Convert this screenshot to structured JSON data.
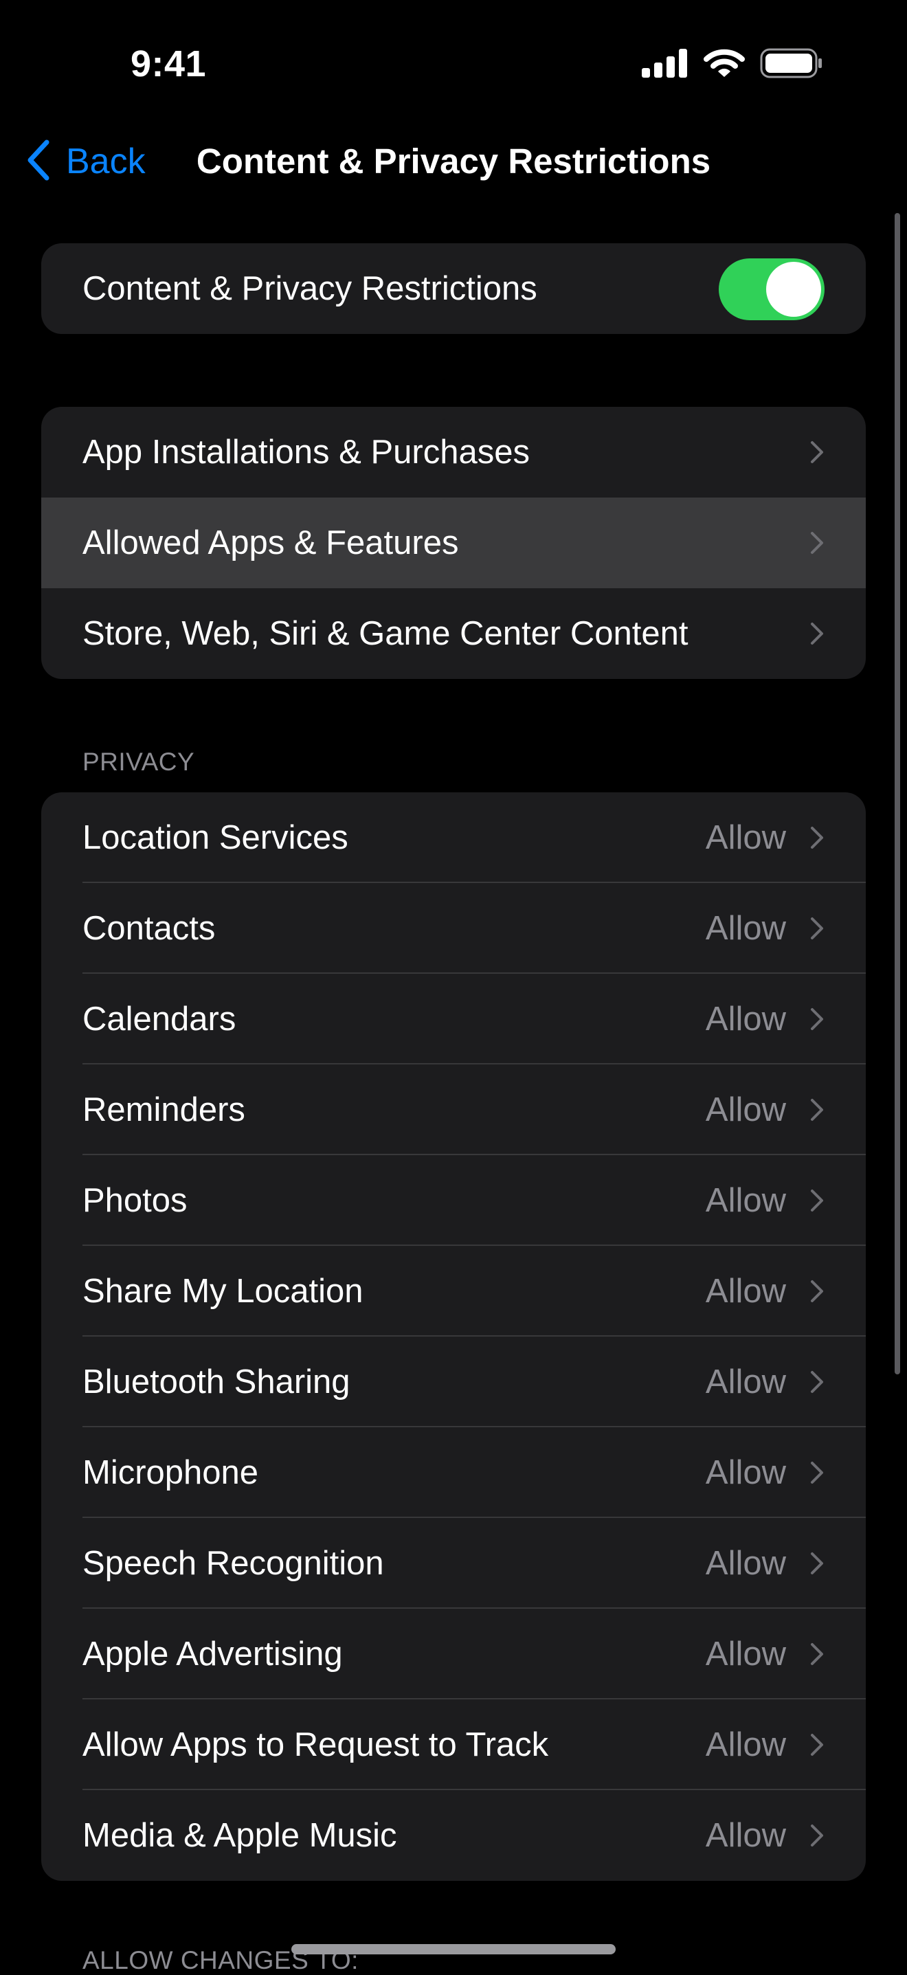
{
  "status_bar": {
    "time": "9:41",
    "icons": [
      "cellular-signal-icon",
      "wifi-icon",
      "battery-icon"
    ]
  },
  "nav": {
    "back_label": "Back",
    "title": "Content & Privacy Restrictions",
    "accent_color": "#0a84ff"
  },
  "master_toggle": {
    "label": "Content & Privacy Restrictions",
    "state": "on",
    "on_color": "#30d158"
  },
  "restrictions_group": {
    "items": [
      {
        "label": "App Installations & Purchases"
      },
      {
        "label": "Allowed Apps & Features",
        "highlighted": true
      },
      {
        "label": "Store, Web, Siri & Game Center Content"
      }
    ]
  },
  "privacy_section": {
    "header": "PRIVACY",
    "items": [
      {
        "label": "Location Services",
        "value": "Allow"
      },
      {
        "label": "Contacts",
        "value": "Allow"
      },
      {
        "label": "Calendars",
        "value": "Allow"
      },
      {
        "label": "Reminders",
        "value": "Allow"
      },
      {
        "label": "Photos",
        "value": "Allow"
      },
      {
        "label": "Share My Location",
        "value": "Allow"
      },
      {
        "label": "Bluetooth Sharing",
        "value": "Allow"
      },
      {
        "label": "Microphone",
        "value": "Allow"
      },
      {
        "label": "Speech Recognition",
        "value": "Allow"
      },
      {
        "label": "Apple Advertising",
        "value": "Allow"
      },
      {
        "label": "Allow Apps to Request to Track",
        "value": "Allow"
      },
      {
        "label": "Media & Apple Music",
        "value": "Allow"
      }
    ]
  },
  "allow_changes_section": {
    "header": "ALLOW CHANGES TO:"
  }
}
